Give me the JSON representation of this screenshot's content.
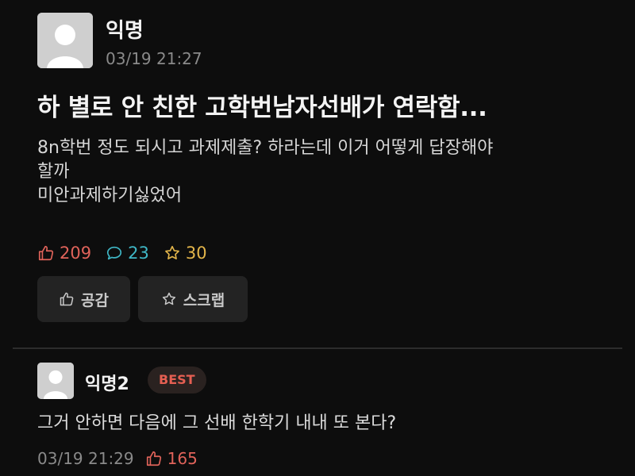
{
  "post": {
    "author": "익명",
    "time": "03/19 21:27",
    "title": "하 별로 안 친한 고학번남자선배가 연락함...",
    "body_lines": [
      "8n학번 정도 되시고 과제제출? 하라는데 이거 어떻게 답장해야",
      "할까",
      "미안과제하기싫었어"
    ],
    "likes": "209",
    "comments": "23",
    "scraps": "30",
    "like_button_label": "공감",
    "scrap_button_label": "스크랩"
  },
  "comment": {
    "author": "익명2",
    "badge": "BEST",
    "text": "그거 안하면 다음에 그 선배 한학기 내내 또 본다?",
    "time": "03/19 21:29",
    "likes": "165"
  },
  "colors": {
    "background": "#0d0d0d",
    "like": "#e0635a",
    "comment": "#3fb7c6",
    "scrap": "#e3b54a",
    "best_badge": "#e55f52"
  },
  "icons": [
    "user-avatar-icon",
    "thumbs-up-icon",
    "comment-bubble-icon",
    "star-icon"
  ]
}
